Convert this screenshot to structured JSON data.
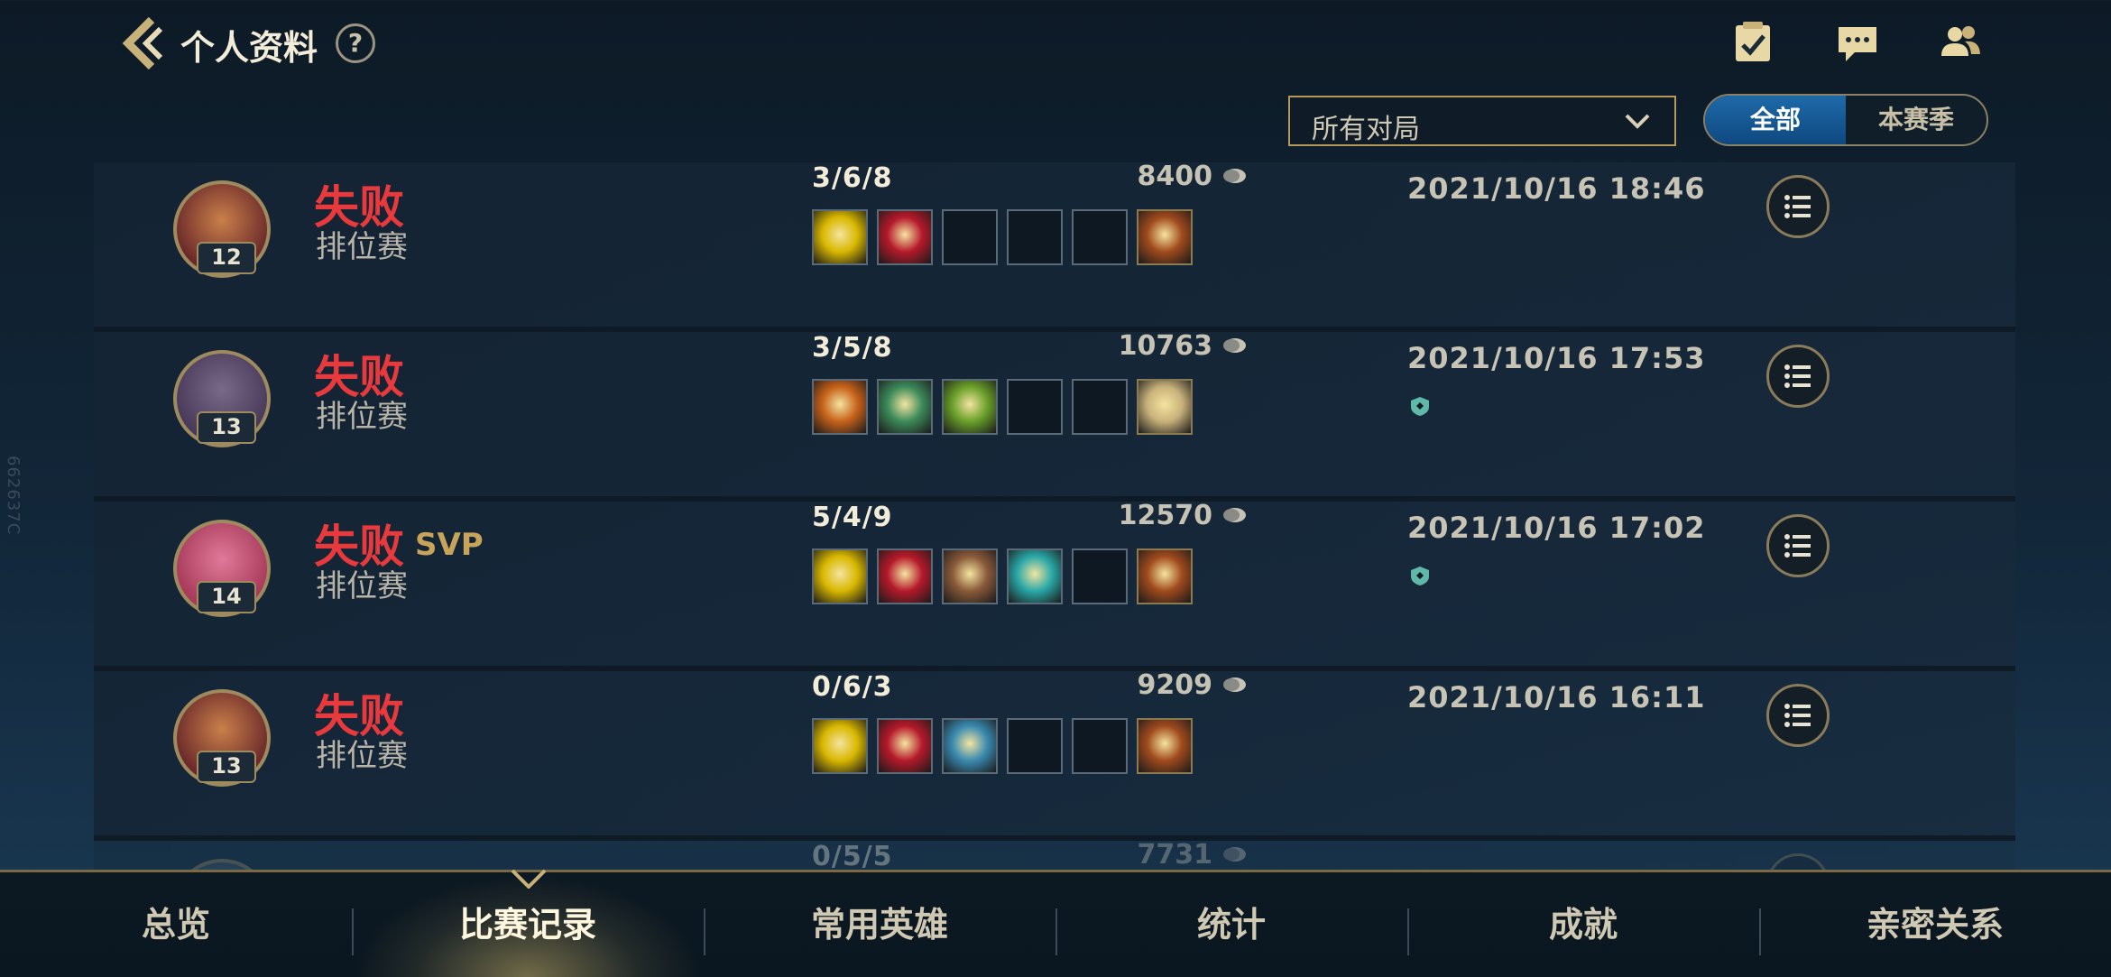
{
  "side_id": "662637C",
  "header": {
    "title": "个人资料",
    "help": "?"
  },
  "filter": {
    "label": "所有对局"
  },
  "segment": {
    "all": "全部",
    "season": "本赛季"
  },
  "matches": [
    {
      "level": "12",
      "result": "失败",
      "svp": "",
      "mode": "排位赛",
      "kda": "3/6/8",
      "gold": "8400",
      "date": "2021/10/16 18:46",
      "badge": false,
      "items": [
        "#d9b800",
        "#b5192a",
        "",
        "",
        "",
        "#a04a1c"
      ],
      "avatar": [
        "#6b2a2a",
        "#c9804a"
      ]
    },
    {
      "level": "13",
      "result": "失败",
      "svp": "",
      "mode": "排位赛",
      "kda": "3/5/8",
      "gold": "10763",
      "date": "2021/10/16 17:53",
      "badge": true,
      "items": [
        "#c8621a",
        "#3c8a5a",
        "#6aa02a",
        "",
        "",
        "#c9b27a"
      ],
      "avatar": [
        "#4a3a5a",
        "#7a6a8a"
      ]
    },
    {
      "level": "14",
      "result": "失败",
      "svp": "SVP",
      "mode": "排位赛",
      "kda": "5/4/9",
      "gold": "12570",
      "date": "2021/10/16 17:02",
      "badge": true,
      "items": [
        "#d9b800",
        "#b5192a",
        "#8a5a3a",
        "#2aa8a8",
        "",
        "#a04a1c"
      ],
      "avatar": [
        "#a83a5a",
        "#e07a9a"
      ]
    },
    {
      "level": "13",
      "result": "失败",
      "svp": "",
      "mode": "排位赛",
      "kda": "0/6/3",
      "gold": "9209",
      "date": "2021/10/16 16:11",
      "badge": false,
      "items": [
        "#d9b800",
        "#b5192a",
        "#3a8ab0",
        "",
        "",
        "#a04a1c"
      ],
      "avatar": [
        "#6b2a2a",
        "#c9804a"
      ]
    },
    {
      "level": "",
      "result": "",
      "svp": "",
      "mode": "",
      "kda": "0/5/5",
      "gold": "7731",
      "date": "",
      "badge": false,
      "items": [
        "",
        "",
        "",
        "",
        "",
        ""
      ],
      "avatar": [
        "#3a4a5a",
        "#5a6a7a"
      ]
    }
  ],
  "tabs": [
    {
      "label": "总览"
    },
    {
      "label": "比赛记录",
      "active": true
    },
    {
      "label": "常用英雄"
    },
    {
      "label": "统计"
    },
    {
      "label": "成就"
    },
    {
      "label": "亲密关系"
    }
  ]
}
